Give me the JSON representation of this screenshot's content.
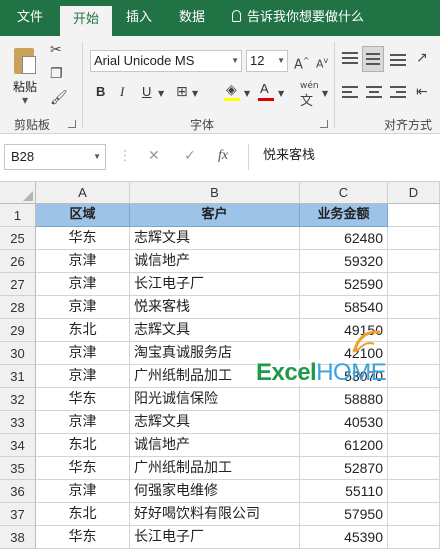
{
  "tabs": [
    {
      "label": "文件",
      "active": false
    },
    {
      "label": "开始",
      "active": true
    },
    {
      "label": "插入",
      "active": false
    },
    {
      "label": "数据",
      "active": false
    }
  ],
  "tell_me": "告诉我你想要做什么",
  "ribbon": {
    "paste_label": "粘贴",
    "clipboard_label": "剪贴板",
    "font_label": "字体",
    "alignment_label": "对齐方式",
    "font_name": "Arial Unicode MS",
    "font_size": "12",
    "bold": "B",
    "italic": "I",
    "underline": "U",
    "font_color_a": "A",
    "wen": "wén",
    "wen_char": "文",
    "highlight_color": "#ffff00",
    "font_color": "#e00000"
  },
  "formula_bar": {
    "name_box": "B28",
    "fx": "fx",
    "content": "悦来客栈"
  },
  "columns": [
    "A",
    "B",
    "C",
    "D"
  ],
  "header_row": {
    "row": "1",
    "a": "区域",
    "b": "客户",
    "c": "业务金额"
  },
  "rows": [
    {
      "row": "25",
      "a": "华东",
      "b": "志辉文具",
      "c": "62480"
    },
    {
      "row": "26",
      "a": "京津",
      "b": "诚信地产",
      "c": "59320"
    },
    {
      "row": "27",
      "a": "京津",
      "b": "长江电子厂",
      "c": "52590"
    },
    {
      "row": "28",
      "a": "京津",
      "b": "悦来客栈",
      "c": "58540"
    },
    {
      "row": "29",
      "a": "东北",
      "b": "志辉文具",
      "c": "49150"
    },
    {
      "row": "30",
      "a": "京津",
      "b": "淘宝真诚服务店",
      "c": "42100"
    },
    {
      "row": "31",
      "a": "京津",
      "b": "广州纸制品加工",
      "c": "53070"
    },
    {
      "row": "32",
      "a": "华东",
      "b": "阳光诚信保险",
      "c": "58880"
    },
    {
      "row": "33",
      "a": "京津",
      "b": "志辉文具",
      "c": "40530"
    },
    {
      "row": "34",
      "a": "东北",
      "b": "诚信地产",
      "c": "61200"
    },
    {
      "row": "35",
      "a": "华东",
      "b": "广州纸制品加工",
      "c": "52870"
    },
    {
      "row": "36",
      "a": "京津",
      "b": "何强家电维修",
      "c": "55110"
    },
    {
      "row": "37",
      "a": "东北",
      "b": "好好喝饮料有限公司",
      "c": "57950"
    },
    {
      "row": "38",
      "a": "华东",
      "b": "长江电子厂",
      "c": "45390"
    }
  ],
  "watermark": {
    "excel": "Excel",
    "home": "HOME"
  },
  "colors": {
    "excel_green": "#217346",
    "header_fill": "#9dc3e6"
  }
}
